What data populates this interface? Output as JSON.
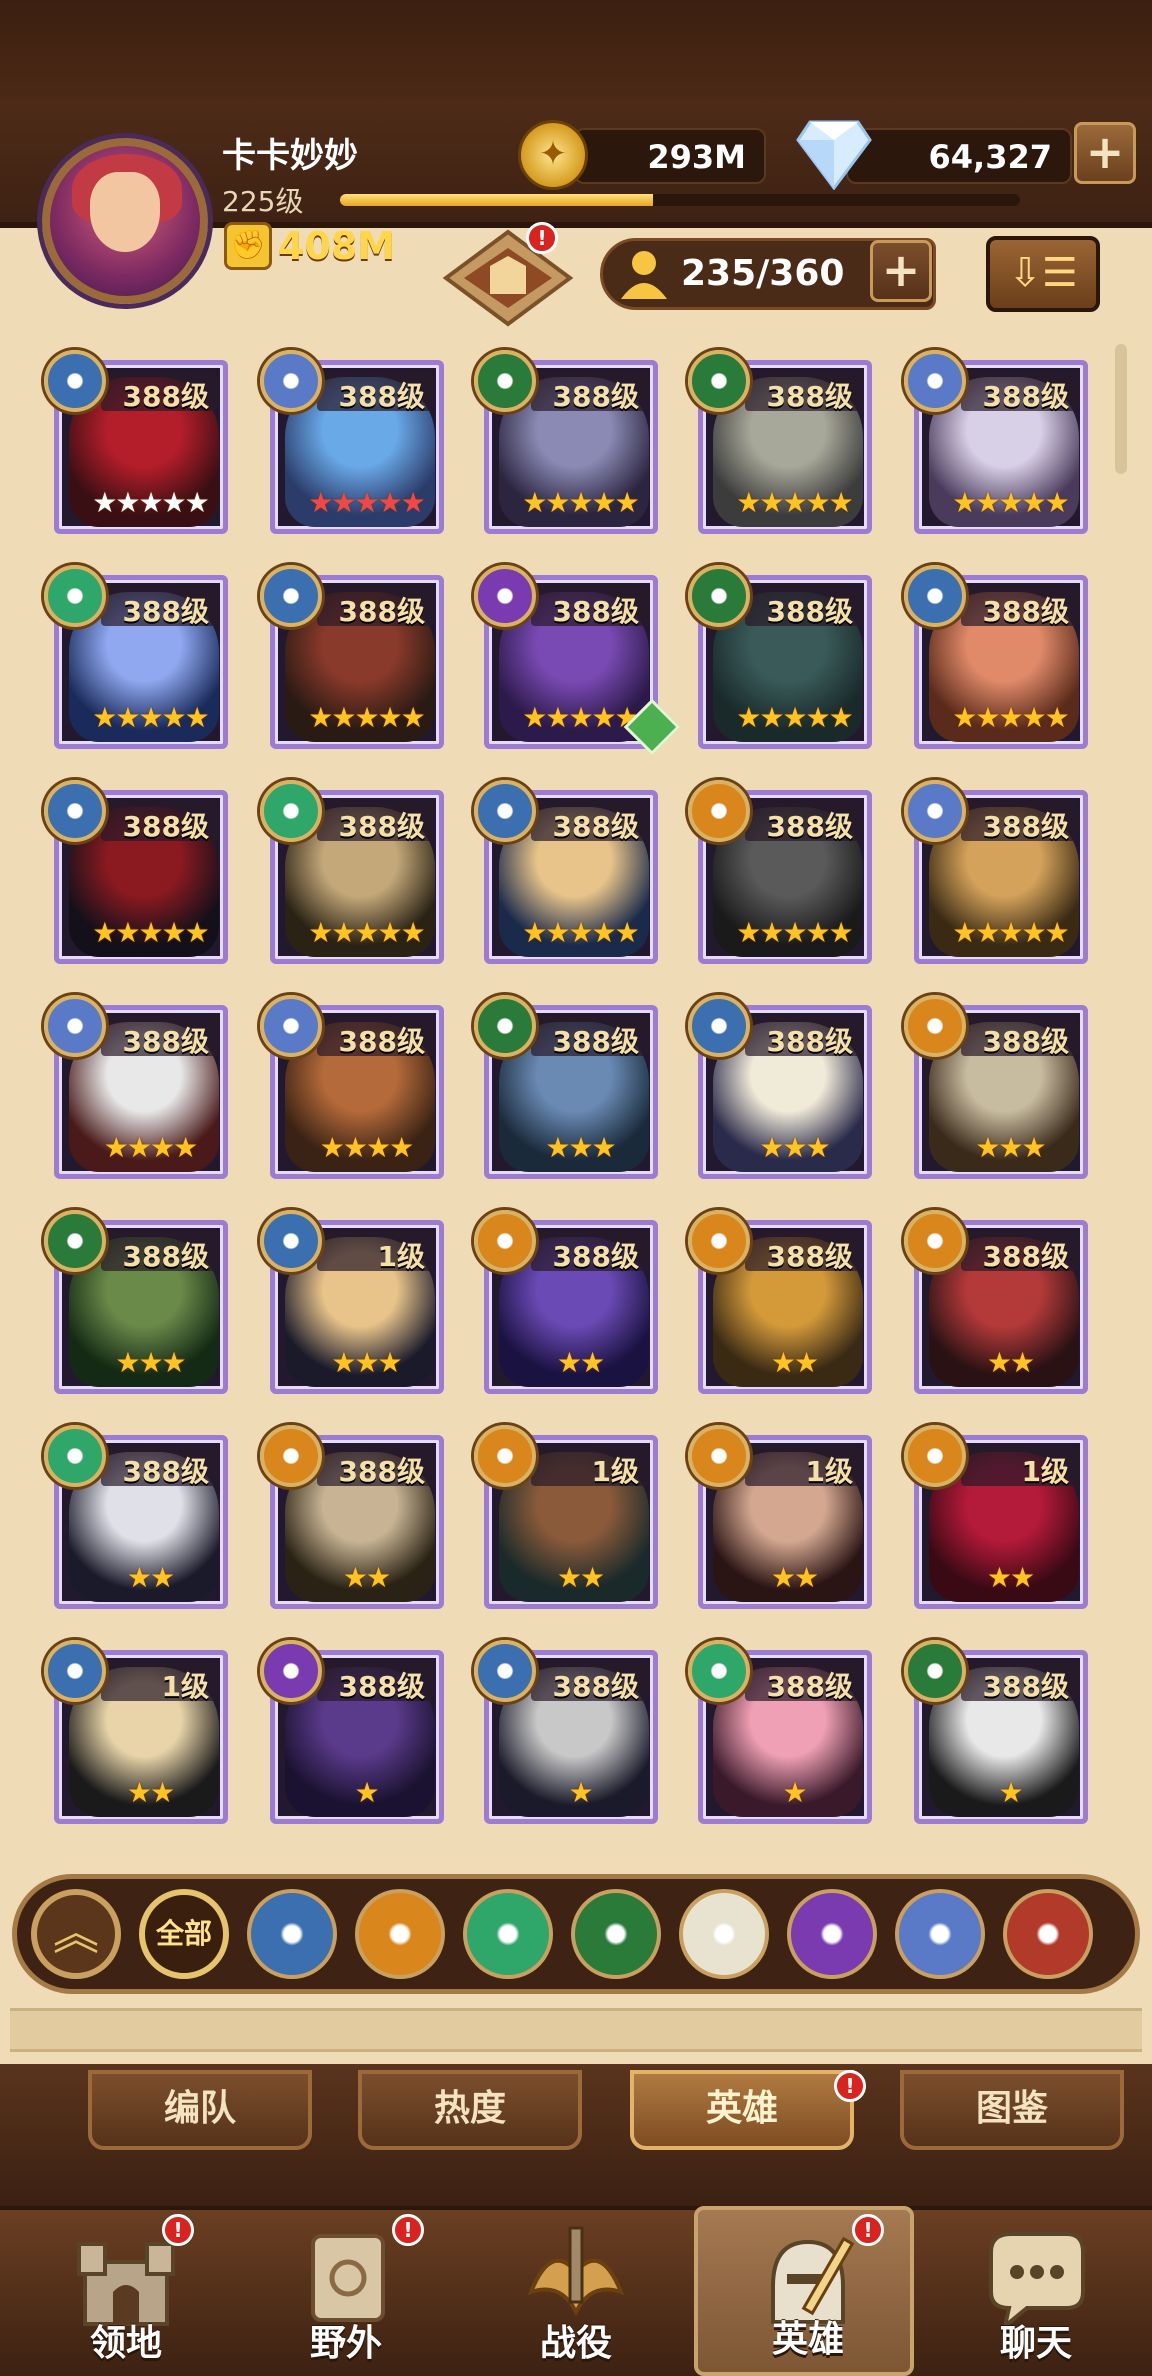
{
  "player": {
    "name": "卡卡妙妙",
    "level": "225级",
    "power": "408M",
    "xp_fraction": 0.46
  },
  "resources": {
    "gold": "293M",
    "diamonds": "64,327"
  },
  "hero_count": "235/360",
  "alerts": {
    "badge": "!",
    "heroes_tab": "!",
    "nav_territory": "!",
    "nav_wild": "!",
    "nav_heroes": "!"
  },
  "faction_colors": {
    "lightbearer": "#3b6fb0",
    "mauler": "#d9861d",
    "wilder": "#2fa66a",
    "graveborn": "#2a7a3a",
    "celestial": "#e8e2d0",
    "hypogean": "#7a3ab0",
    "dimensional": "#5a7ac8",
    "rune": "#b23a2a"
  },
  "heroes": [
    {
      "faction": "lightbearer",
      "level": "388级",
      "stars": 5,
      "star_color": "white",
      "colors": [
        "#3a0f14",
        "#b41e2a"
      ]
    },
    {
      "faction": "dimensional",
      "level": "388级",
      "stars": 5,
      "star_color": "red",
      "colors": [
        "#2b3c6a",
        "#6aa9e8"
      ]
    },
    {
      "faction": "graveborn",
      "level": "388级",
      "stars": 5,
      "star_color": "gold",
      "colors": [
        "#2c2540",
        "#8a8ab4"
      ]
    },
    {
      "faction": "graveborn",
      "level": "388级",
      "stars": 5,
      "star_color": "gold",
      "colors": [
        "#3c3c3c",
        "#a8a89a"
      ]
    },
    {
      "faction": "dimensional",
      "level": "388级",
      "stars": 5,
      "star_color": "gold",
      "colors": [
        "#4a3a5c",
        "#d8d0e6"
      ]
    },
    {
      "faction": "wilder",
      "level": "388级",
      "stars": 5,
      "star_color": "gold",
      "colors": [
        "#1a2a5a",
        "#8fa8f0"
      ]
    },
    {
      "faction": "lightbearer",
      "level": "388级",
      "stars": 5,
      "star_color": "gold",
      "colors": [
        "#2a1a14",
        "#8a3a2a"
      ]
    },
    {
      "faction": "hypogean",
      "level": "388级",
      "stars": 5,
      "star_color": "gold",
      "colors": [
        "#2c1a4a",
        "#7a4ab4"
      ]
    },
    {
      "faction": "graveborn",
      "level": "388级",
      "stars": 5,
      "star_color": "gold",
      "colors": [
        "#1a2a2a",
        "#3a5a5a"
      ]
    },
    {
      "faction": "lightbearer",
      "level": "388级",
      "stars": 5,
      "star_color": "gold",
      "colors": [
        "#5a2a1a",
        "#e08a6a"
      ]
    },
    {
      "faction": "lightbearer",
      "level": "388级",
      "stars": 5,
      "star_color": "gold",
      "colors": [
        "#14101a",
        "#8a1a20"
      ]
    },
    {
      "faction": "wilder",
      "level": "388级",
      "stars": 5,
      "star_color": "gold",
      "colors": [
        "#2a2214",
        "#c4a87a"
      ]
    },
    {
      "faction": "lightbearer",
      "level": "388级",
      "stars": 5,
      "star_color": "gold",
      "colors": [
        "#1a2a4a",
        "#e8c48a"
      ]
    },
    {
      "faction": "mauler",
      "level": "388级",
      "stars": 5,
      "star_color": "gold",
      "colors": [
        "#1a1a1a",
        "#5a5a5a"
      ]
    },
    {
      "faction": "dimensional",
      "level": "388级",
      "stars": 5,
      "star_color": "gold",
      "colors": [
        "#3a2a14",
        "#d4a25a"
      ]
    },
    {
      "faction": "dimensional",
      "level": "388级",
      "stars": 4,
      "star_color": "gold",
      "colors": [
        "#4a1a1a",
        "#e8e8e8"
      ]
    },
    {
      "faction": "dimensional",
      "level": "388级",
      "stars": 4,
      "star_color": "gold",
      "colors": [
        "#3a2214",
        "#b46a3a"
      ]
    },
    {
      "faction": "graveborn",
      "level": "388级",
      "stars": 3,
      "star_color": "gold",
      "colors": [
        "#1a2a3a",
        "#6a8ab4"
      ]
    },
    {
      "faction": "lightbearer",
      "level": "388级",
      "stars": 3,
      "star_color": "gold",
      "colors": [
        "#2a2a4a",
        "#f0ead8"
      ]
    },
    {
      "faction": "mauler",
      "level": "388级",
      "stars": 3,
      "star_color": "gold",
      "colors": [
        "#3a2a1a",
        "#c8bca0"
      ]
    },
    {
      "faction": "graveborn",
      "level": "388级",
      "stars": 3,
      "star_color": "gold",
      "colors": [
        "#142a14",
        "#6a8a4a"
      ]
    },
    {
      "faction": "lightbearer",
      "level": "1级",
      "stars": 3,
      "star_color": "gold",
      "colors": [
        "#1a1a2a",
        "#e8c48a"
      ]
    },
    {
      "faction": "mauler",
      "level": "388级",
      "stars": 2,
      "star_color": "gold",
      "colors": [
        "#1a1240",
        "#6a4ab4"
      ]
    },
    {
      "faction": "mauler",
      "level": "388级",
      "stars": 2,
      "star_color": "gold",
      "colors": [
        "#3a2a14",
        "#d49a3a"
      ]
    },
    {
      "faction": "mauler",
      "level": "388级",
      "stars": 2,
      "star_color": "gold",
      "colors": [
        "#2a1214",
        "#b43a3a"
      ]
    },
    {
      "faction": "wilder",
      "level": "388级",
      "stars": 2,
      "star_color": "gold",
      "colors": [
        "#1a1a2a",
        "#e0e0e8"
      ]
    },
    {
      "faction": "mauler",
      "level": "388级",
      "stars": 2,
      "star_color": "gold",
      "colors": [
        "#2a2214",
        "#c8b494"
      ]
    },
    {
      "faction": "mauler",
      "level": "1级",
      "stars": 2,
      "star_color": "gold",
      "colors": [
        "#1a2a2a",
        "#8a5a3a"
      ]
    },
    {
      "faction": "mauler",
      "level": "1级",
      "stars": 2,
      "star_color": "gold",
      "colors": [
        "#2a1414",
        "#d4a890"
      ]
    },
    {
      "faction": "mauler",
      "level": "1级",
      "stars": 2,
      "star_color": "gold",
      "colors": [
        "#3a0a14",
        "#b41a3a"
      ]
    },
    {
      "faction": "lightbearer",
      "level": "1级",
      "stars": 2,
      "star_color": "gold",
      "colors": [
        "#1a1a1a",
        "#e8d4a8"
      ]
    },
    {
      "faction": "hypogean",
      "level": "388级",
      "stars": 1,
      "star_color": "gold",
      "colors": [
        "#1a1230",
        "#5a3a8a"
      ]
    },
    {
      "faction": "lightbearer",
      "level": "388级",
      "stars": 1,
      "star_color": "gold",
      "colors": [
        "#1a1a2a",
        "#c8c8c8"
      ]
    },
    {
      "faction": "wilder",
      "level": "388级",
      "stars": 1,
      "star_color": "gold",
      "colors": [
        "#3a1a2a",
        "#f0a0b4"
      ]
    },
    {
      "faction": "graveborn",
      "level": "388级",
      "stars": 1,
      "star_color": "gold",
      "colors": [
        "#1a1a1a",
        "#e8e8e8"
      ]
    }
  ],
  "filters": [
    {
      "name": "collapse",
      "label": "︽"
    },
    {
      "name": "all",
      "label": "全部"
    },
    {
      "name": "lightbearer"
    },
    {
      "name": "mauler"
    },
    {
      "name": "wilder"
    },
    {
      "name": "graveborn"
    },
    {
      "name": "celestial"
    },
    {
      "name": "hypogean"
    },
    {
      "name": "dimensional"
    },
    {
      "name": "rune"
    }
  ],
  "tabs": {
    "formation": "编队",
    "popularity": "热度",
    "heroes": "英雄",
    "codex": "图鉴"
  },
  "nav": {
    "territory": "领地",
    "wild": "野外",
    "campaign": "战役",
    "heroes": "英雄",
    "chat": "聊天"
  }
}
